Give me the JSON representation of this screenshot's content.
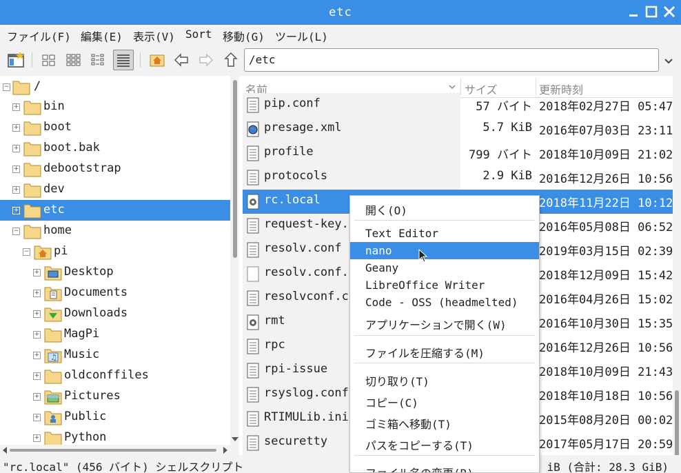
{
  "window": {
    "title": "etc"
  },
  "menu": [
    "ファイル(F)",
    "編集(E)",
    "表示(V)",
    "Sort",
    "移動(G)",
    "ツール(L)"
  ],
  "toolbar": {
    "icons": [
      "new-window-icon",
      "icon-view-icon",
      "thumbnail-view-icon",
      "compact-view-icon",
      "detailed-list-view-icon",
      "home-icon",
      "back-arrow-icon",
      "forward-arrow-icon",
      "up-arrow-icon"
    ],
    "path": "/etc"
  },
  "tree": {
    "root": "/",
    "items": [
      {
        "label": "bin"
      },
      {
        "label": "boot"
      },
      {
        "label": "boot.bak"
      },
      {
        "label": "debootstrap"
      },
      {
        "label": "dev"
      },
      {
        "label": "etc"
      },
      {
        "label": "home"
      },
      {
        "label": "pi"
      },
      {
        "label": "Desktop"
      },
      {
        "label": "Documents"
      },
      {
        "label": "Downloads"
      },
      {
        "label": "MagPi"
      },
      {
        "label": "Music"
      },
      {
        "label": "oldconffiles"
      },
      {
        "label": "Pictures"
      },
      {
        "label": "Public"
      },
      {
        "label": "Python"
      }
    ]
  },
  "list": {
    "columns": [
      "名前",
      "サイズ",
      "更新時刻"
    ],
    "rows": [
      {
        "name": "pip.conf",
        "size": "57 バイト",
        "date": "2018年02月27日 05:47"
      },
      {
        "name": "presage.xml",
        "size": "5.7 KiB",
        "date": "2016年07月03日 23:11"
      },
      {
        "name": "profile",
        "size": "799 バイト",
        "date": "2018年10月09日 21:02"
      },
      {
        "name": "protocols",
        "size": "2.9 KiB",
        "date": "2016年12月26日 10:56"
      },
      {
        "name": "rc.local",
        "size": "",
        "date": "2018年11月22日 10:12"
      },
      {
        "name": "request-key.c",
        "size": "",
        "date": "2016年05月08日 06:52"
      },
      {
        "name": "resolv.conf",
        "size": "",
        "date": "2019年03月15日 02:39"
      },
      {
        "name": "resolv.conf.h",
        "size": "",
        "date": "2018年12月09日 15:42"
      },
      {
        "name": "resolvconf.co",
        "size": "",
        "date": "2016年04月26日 15:02"
      },
      {
        "name": "rmt",
        "size": "",
        "date": "2016年10月30日 15:35"
      },
      {
        "name": "rpc",
        "size": "",
        "date": "2016年12月26日 10:56"
      },
      {
        "name": "rpi-issue",
        "size": "",
        "date": "2018年10月09日 21:43"
      },
      {
        "name": "rsyslog.conf",
        "size": "",
        "date": "2018年10月18日 10:56"
      },
      {
        "name": "RTIMULib.ini",
        "size": "",
        "date": "2015年08月20日 00:02"
      },
      {
        "name": "securetty",
        "size": "",
        "date": "2017年05月17日 20:59"
      }
    ]
  },
  "context_menu": {
    "items": [
      "開く(O)",
      "Text Editor",
      "nano",
      "Geany",
      "LibreOffice Writer",
      "Code - OSS (headmelted)",
      "アプリケーションで開く(W)",
      "ファイルを圧縮する(M)",
      "切り取り(T)",
      "コピー(C)",
      "ゴミ箱へ移動(T)",
      "パスをコピーする(T)",
      "ファイル名の変更(R)"
    ]
  },
  "status": {
    "left": "\"rc.local\" (456 バイト) シェルスクリプト",
    "right": "iB (合計: 28.3 GiB)"
  },
  "colors": {
    "accent": "#3a8ee6",
    "folder": "#f5d78a"
  }
}
